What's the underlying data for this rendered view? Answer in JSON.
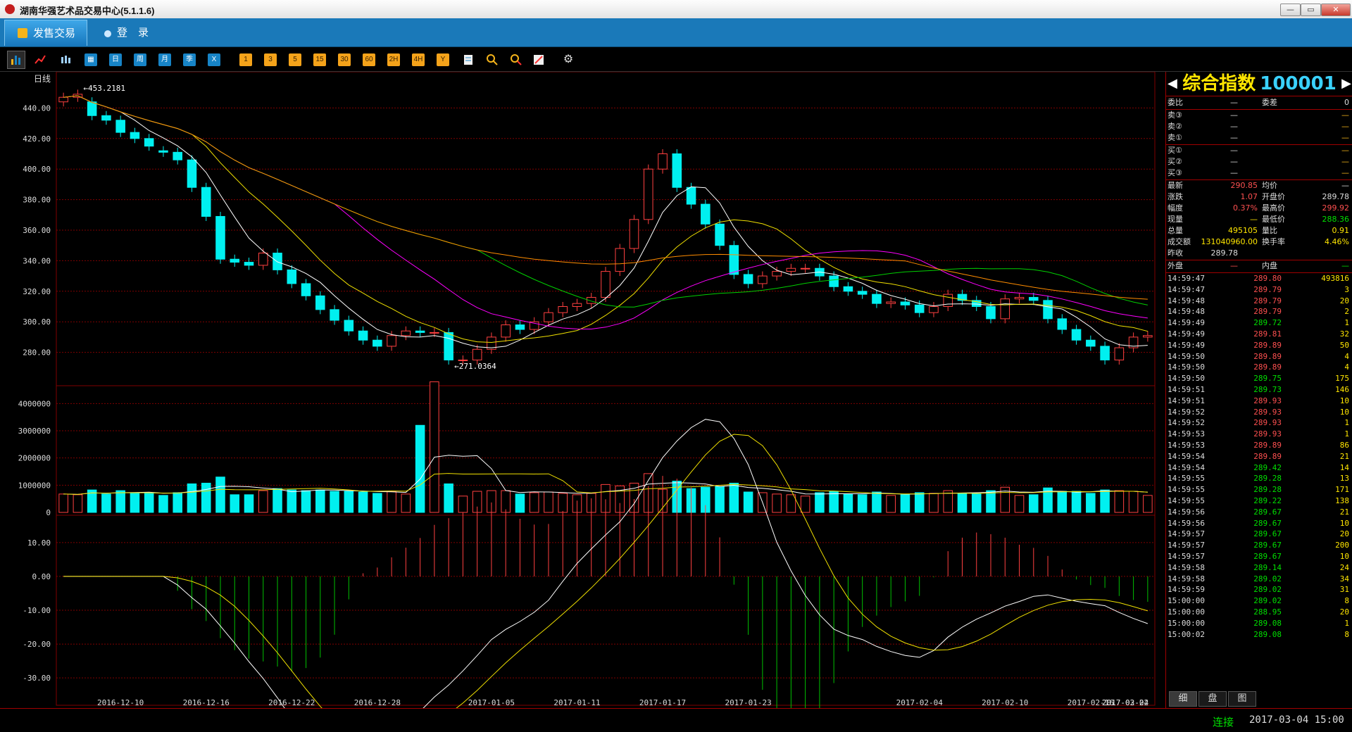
{
  "window": {
    "title": "湖南华强艺术品交易中心(5.1.1.6)",
    "min": "—",
    "max": "▭",
    "close": "✕"
  },
  "menu": {
    "active": "发售交易",
    "login": "登　录"
  },
  "toolbar": {
    "periods": [
      "日",
      "周",
      "月",
      "季",
      "X"
    ],
    "numbers": [
      "1",
      "3",
      "5",
      "15",
      "30",
      "60",
      "2H",
      "4H",
      "Y"
    ]
  },
  "chart": {
    "period_label": "日线",
    "high_label": "453.2181",
    "low_label": "271.0364"
  },
  "chart_data": [
    {
      "type": "candlestick",
      "name": "price",
      "x": [
        "2016-12-06",
        "2016-12-07",
        "2016-12-08",
        "2016-12-09",
        "2016-12-10",
        "2016-12-11",
        "2016-12-12",
        "2016-12-13",
        "2016-12-14",
        "2016-12-15",
        "2016-12-16",
        "2016-12-17",
        "2016-12-18",
        "2016-12-19",
        "2016-12-20",
        "2016-12-21",
        "2016-12-22",
        "2016-12-23",
        "2016-12-24",
        "2016-12-25",
        "2016-12-26",
        "2016-12-27",
        "2016-12-28",
        "2016-12-29",
        "2016-12-30",
        "2016-12-31",
        "2017-01-01",
        "2017-01-02",
        "2017-01-03",
        "2017-01-04",
        "2017-01-05",
        "2017-01-06",
        "2017-01-07",
        "2017-01-08",
        "2017-01-09",
        "2017-01-10",
        "2017-01-11",
        "2017-01-12",
        "2017-01-13",
        "2017-01-14",
        "2017-01-15",
        "2017-01-16",
        "2017-01-17",
        "2017-01-18",
        "2017-01-19",
        "2017-01-20",
        "2017-01-21",
        "2017-01-22",
        "2017-01-23",
        "2017-01-24",
        "2017-01-25",
        "2017-01-26",
        "2017-01-27",
        "2017-01-28",
        "2017-01-29",
        "2017-01-30",
        "2017-01-31",
        "2017-02-01",
        "2017-02-02",
        "2017-02-03",
        "2017-02-04",
        "2017-02-05",
        "2017-02-06",
        "2017-02-07",
        "2017-02-08",
        "2017-02-09",
        "2017-02-10",
        "2017-02-11",
        "2017-02-12",
        "2017-02-13",
        "2017-02-14",
        "2017-02-15",
        "2017-02-16",
        "2017-02-17",
        "2017-02-18",
        "2017-02-19",
        "2017-02-20",
        "2017-02-21",
        "2017-02-22",
        "2017-02-23",
        "2017-02-24",
        "2017-02-25",
        "2017-02-26",
        "2017-02-27",
        "2017-02-28",
        "2017-03-01",
        "2017-03-02",
        "2017-03-03",
        "2017-03-04"
      ],
      "open": [
        444,
        447,
        444,
        435,
        432,
        424,
        420,
        412,
        411,
        406,
        388,
        369,
        341,
        339,
        337,
        345,
        334,
        325,
        317,
        308,
        301,
        294,
        288,
        284,
        291,
        294,
        293,
        293,
        275,
        275,
        282,
        290,
        298,
        295,
        300,
        306,
        310,
        312,
        316,
        333,
        348,
        367,
        400,
        410,
        388,
        377,
        364,
        350,
        331,
        325,
        330,
        333,
        335,
        335,
        330,
        323,
        320,
        318,
        312,
        313,
        311,
        306,
        310,
        318,
        314,
        310,
        302,
        315,
        316,
        314,
        302,
        295,
        288,
        284,
        275,
        283,
        290
      ],
      "close": [
        447,
        449,
        435,
        432,
        424,
        420,
        415,
        411,
        406,
        388,
        369,
        341,
        339,
        337,
        345,
        334,
        325,
        317,
        308,
        301,
        294,
        288,
        284,
        291,
        294,
        293,
        293,
        275,
        275,
        282,
        290,
        298,
        295,
        300,
        306,
        310,
        312,
        316,
        333,
        348,
        367,
        400,
        410,
        388,
        377,
        364,
        350,
        331,
        325,
        330,
        333,
        335,
        335,
        330,
        323,
        320,
        318,
        312,
        313,
        311,
        306,
        310,
        318,
        314,
        310,
        302,
        315,
        316,
        314,
        302,
        295,
        288,
        284,
        275,
        283,
        290,
        291
      ],
      "ymin": 260,
      "ymax": 460
    },
    {
      "type": "bar",
      "name": "volume",
      "ylim": [
        0,
        4500000
      ],
      "ticks": [
        "0",
        "1000000",
        "2000000",
        "3000000",
        "4000000"
      ]
    },
    {
      "type": "line",
      "name": "macd",
      "ticks": [
        "10.00",
        "0.00",
        "-10.00",
        "-20.00",
        "-30.00"
      ],
      "ylim": [
        -36,
        16
      ]
    }
  ],
  "y_ticks_price": [
    "440.00",
    "420.00",
    "400.00",
    "380.00",
    "360.00",
    "340.00",
    "320.00",
    "300.00",
    "280.00"
  ],
  "x_ticks": [
    "2016-12-10",
    "2016-12-16",
    "2016-12-22",
    "2016-12-28",
    "2017-01-05",
    "2017-01-11",
    "2017-01-17",
    "2017-01-23",
    "2017-02-04",
    "2017-02-10",
    "2017-02-16",
    "2017-02-22",
    "2017-03-04"
  ],
  "quote": {
    "name": "综合指数",
    "code": "100001",
    "weibi_label": "委比",
    "weibi": "—",
    "weicha_label": "委差",
    "weicha": "0",
    "sell": [
      {
        "label": "卖③",
        "p": "—",
        "v": "—"
      },
      {
        "label": "卖②",
        "p": "—",
        "v": "—"
      },
      {
        "label": "卖①",
        "p": "—",
        "v": "—"
      }
    ],
    "buy": [
      {
        "label": "买①",
        "p": "—",
        "v": "—"
      },
      {
        "label": "买②",
        "p": "—",
        "v": "—"
      },
      {
        "label": "买③",
        "p": "—",
        "v": "—"
      }
    ],
    "latest_label": "最新",
    "latest": "290.85",
    "avg_label": "均价",
    "avg": "—",
    "change_label": "涨跌",
    "change": "1.07",
    "open_label": "开盘价",
    "open": "289.78",
    "pct_label": "幅度",
    "pct": "0.37%",
    "high_label": "最高价",
    "high": "299.92",
    "cur_vol_label": "现量",
    "cur_vol": "—",
    "low_label": "最低价",
    "low": "288.36",
    "total_vol_label": "总量",
    "total_vol": "495105",
    "vol_ratio_label": "量比",
    "vol_ratio": "0.91",
    "turnover_label": "成交额",
    "turnover": "131040960.00",
    "turn_rate_label": "换手率",
    "turn_rate": "4.46%",
    "prev_close_label": "昨收",
    "prev_close": "289.78",
    "outer_label": "外盘",
    "outer": "—",
    "inner_label": "内盘",
    "inner": "—"
  },
  "ticks": [
    {
      "t": "14:59:47",
      "p": "289.80",
      "v": "493816",
      "c": "#ff5050"
    },
    {
      "t": "14:59:47",
      "p": "289.79",
      "v": "3",
      "c": "#ff5050"
    },
    {
      "t": "14:59:48",
      "p": "289.79",
      "v": "20",
      "c": "#ff5050"
    },
    {
      "t": "14:59:48",
      "p": "289.79",
      "v": "2",
      "c": "#ff5050"
    },
    {
      "t": "14:59:49",
      "p": "289.72",
      "v": "1",
      "c": "#00e000"
    },
    {
      "t": "14:59:49",
      "p": "289.81",
      "v": "32",
      "c": "#ff5050"
    },
    {
      "t": "14:59:49",
      "p": "289.89",
      "v": "50",
      "c": "#ff5050"
    },
    {
      "t": "14:59:50",
      "p": "289.89",
      "v": "4",
      "c": "#ff5050"
    },
    {
      "t": "14:59:50",
      "p": "289.89",
      "v": "4",
      "c": "#ff5050"
    },
    {
      "t": "14:59:50",
      "p": "289.75",
      "v": "175",
      "c": "#00e000"
    },
    {
      "t": "14:59:51",
      "p": "289.73",
      "v": "146",
      "c": "#00e000"
    },
    {
      "t": "14:59:51",
      "p": "289.93",
      "v": "10",
      "c": "#ff5050"
    },
    {
      "t": "14:59:52",
      "p": "289.93",
      "v": "10",
      "c": "#ff5050"
    },
    {
      "t": "14:59:52",
      "p": "289.93",
      "v": "1",
      "c": "#ff5050"
    },
    {
      "t": "14:59:53",
      "p": "289.93",
      "v": "1",
      "c": "#ff5050"
    },
    {
      "t": "14:59:53",
      "p": "289.89",
      "v": "86",
      "c": "#ff5050"
    },
    {
      "t": "14:59:54",
      "p": "289.89",
      "v": "21",
      "c": "#ff5050"
    },
    {
      "t": "14:59:54",
      "p": "289.42",
      "v": "14",
      "c": "#00e000"
    },
    {
      "t": "14:59:55",
      "p": "289.28",
      "v": "13",
      "c": "#00e000"
    },
    {
      "t": "14:59:55",
      "p": "289.28",
      "v": "171",
      "c": "#00e000"
    },
    {
      "t": "14:59:55",
      "p": "289.22",
      "v": "138",
      "c": "#00e000"
    },
    {
      "t": "14:59:56",
      "p": "289.67",
      "v": "21",
      "c": "#00e000"
    },
    {
      "t": "14:59:56",
      "p": "289.67",
      "v": "10",
      "c": "#00e000"
    },
    {
      "t": "14:59:57",
      "p": "289.67",
      "v": "20",
      "c": "#00e000"
    },
    {
      "t": "14:59:57",
      "p": "289.67",
      "v": "200",
      "c": "#00e000"
    },
    {
      "t": "14:59:57",
      "p": "289.67",
      "v": "10",
      "c": "#00e000"
    },
    {
      "t": "14:59:58",
      "p": "289.14",
      "v": "24",
      "c": "#00e000"
    },
    {
      "t": "14:59:58",
      "p": "289.02",
      "v": "34",
      "c": "#00e000"
    },
    {
      "t": "14:59:59",
      "p": "289.02",
      "v": "31",
      "c": "#00e000"
    },
    {
      "t": "15:00:00",
      "p": "289.02",
      "v": "8",
      "c": "#00e000"
    },
    {
      "t": "15:00:00",
      "p": "288.95",
      "v": "20",
      "c": "#00e000"
    },
    {
      "t": "15:00:00",
      "p": "289.08",
      "v": "1",
      "c": "#00e000"
    },
    {
      "t": "15:00:02",
      "p": "289.08",
      "v": "8",
      "c": "#00e000"
    }
  ],
  "tabs": [
    "细",
    "盘",
    "图"
  ],
  "status": {
    "conn": "连接",
    "time": "2017-03-04 15:00"
  },
  "colors": {
    "up": "#ff4040",
    "down": "#00f0f0",
    "grid": "#800000"
  }
}
